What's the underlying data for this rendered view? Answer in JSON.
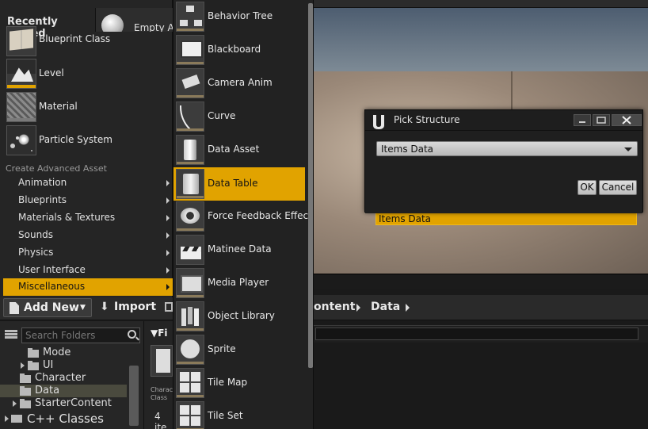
{
  "menu": {
    "recently_placed": "Recently Placed",
    "empty_actor": "Empty A",
    "basic_assets": [
      "Blueprint Class",
      "Level",
      "Material",
      "Particle System"
    ],
    "advanced_section": "Create Advanced Asset",
    "categories": [
      "Animation",
      "Blueprints",
      "Materials & Textures",
      "Sounds",
      "Physics",
      "User Interface",
      "Miscellaneous"
    ],
    "selected_category": "Miscellaneous"
  },
  "submenu": {
    "items": [
      "Behavior Tree",
      "Blackboard",
      "Camera Anim",
      "Curve",
      "Data Asset",
      "Data Table",
      "Force Feedback Effect",
      "Matinee Data",
      "Media Player",
      "Object Library",
      "Sprite",
      "Tile Map",
      "Tile Set"
    ],
    "selected": "Data Table"
  },
  "dialog": {
    "title": "Pick Structure",
    "selected_structure": "Items Data",
    "ok_label": "OK",
    "cancel_label": "Cancel"
  },
  "background": {
    "highlighted_row": "Items Data"
  },
  "content_browser": {
    "add_new_label": "Add New",
    "import_label": "Import",
    "breadcrumb": [
      "ontent",
      "Data"
    ],
    "folder_search_placeholder": "Search Folders",
    "folders": [
      "Mode",
      "UI",
      "Character",
      "Data",
      "StarterContent"
    ],
    "selected_folder": "Data",
    "cpp_classes": "C++ Classes",
    "filter_label": "Fi",
    "asset_tile_label": "Characte Class",
    "item_count": "4 ite"
  },
  "colors": {
    "accent": "#e1a300",
    "panel_bg": "#252525"
  }
}
